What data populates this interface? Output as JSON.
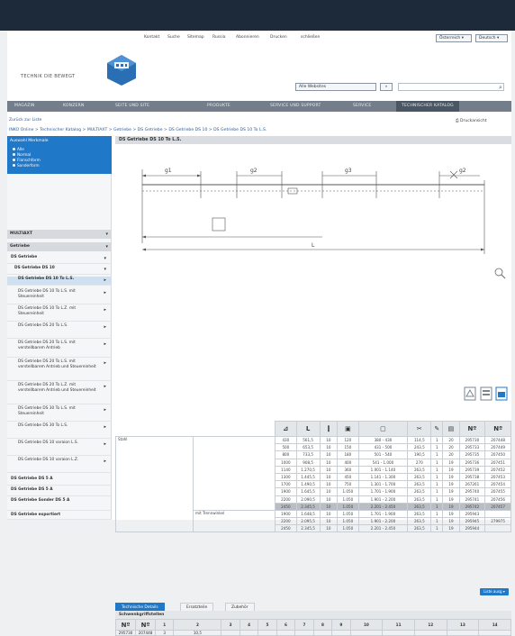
{
  "top_nav": {
    "links": [
      "Kontakt",
      "Suche",
      "Sitemap",
      "Russia",
      "Abonnieren",
      "Drucken",
      "schließen"
    ],
    "lang_selects": [
      "Österreich ▾",
      "Deutsch ▾"
    ]
  },
  "brand": {
    "tagline": "TECHNIK DIE BEWEGT"
  },
  "search": {
    "select_value": "Alle Websites",
    "go_label": "»",
    "placeholder": ""
  },
  "main_nav": [
    "MAGAZIN",
    "KONZERN",
    "SEITE UND SITE",
    "PRODUKTE",
    "SERVICE UND SUPPORT",
    "SERVICE",
    "TECHNISCHER KATALOG"
  ],
  "sub_bar": {
    "left_link": "Zurück zur Liste",
    "right_link": "Druckansicht"
  },
  "breadcrumb": "INKO Online > Technischer Katalog > MULTIAXT > Getriebe > DS Getriebe > DS Getriebe DS 10 > DS Getriebe DS 10 To L.S.",
  "sidebar": {
    "filter_title": "Auswahl Merkmale",
    "filter_options": [
      "Alle",
      "Normal",
      "Flanschform",
      "Sonderform"
    ],
    "sections": [
      {
        "label": "MULTIAXT",
        "arrow": "▾"
      },
      {
        "label": "Getriebe",
        "arrow": "▾"
      }
    ],
    "items": [
      {
        "label": "DS Getriebe",
        "arrow": "▾"
      },
      {
        "label": "DS Getriebe DS 10",
        "arrow": "▾"
      },
      {
        "label": "DS Getriebe DS 10 To L.S.",
        "arrow": "▸"
      },
      {
        "label": "DS Getriebe DS 10 To L.S. mit Steuereinheit",
        "arrow": "▸"
      },
      {
        "label": "DS Getriebe DS 10 To L.Z. mit Steuereinheit",
        "arrow": "▸"
      },
      {
        "label": "DS Getriebe DS 20 To L.S.",
        "arrow": "▸"
      },
      {
        "label": "DS Getriebe DS 20 To L.S. mit verstellbarem Antrieb",
        "arrow": "▸"
      },
      {
        "label": "DS Getriebe DS 20 To L.S. mit verstellbarem Antrieb und Steuereinheit",
        "arrow": "▸"
      },
      {
        "label": "DS Getriebe DS 20 To L.Z. mit verstellbarem Antrieb und Steuereinheit",
        "arrow": "▸"
      },
      {
        "label": "DS Getriebe DS 30 To L.S. mit Steuereinheit",
        "arrow": "▸"
      },
      {
        "label": "DS Getriebe DS 30 To L.S.",
        "arrow": "▸"
      },
      {
        "label": "DS Getriebe DS 10 varaion L.S.",
        "arrow": "▸"
      },
      {
        "label": "DS Getriebe DS 10 varaion L.Z.",
        "arrow": "▸"
      },
      {
        "label": "DS Getriebe DS 5 A",
        "arrow": ""
      },
      {
        "label": "DS Getriebe DS 5 A",
        "arrow": ""
      },
      {
        "label": "DS Getriebe Sonder DS 5 A",
        "arrow": ""
      },
      {
        "label": "DS Getriebe exportiert",
        "arrow": ""
      }
    ]
  },
  "product": {
    "title": "DS Getriebe DS 10 To L.S.",
    "drawing_labels": [
      "g1",
      "g2",
      "g3",
      "L",
      "g2"
    ]
  },
  "price_table": {
    "head_symbols": [
      "L",
      "",
      "",
      "",
      "",
      "",
      "",
      "Nº",
      "Nº"
    ],
    "group_labels": {
      "row0": "Stahl",
      "row12": "mit Trennwinkel"
    },
    "rows": [
      [
        "430",
        "561,5",
        "10",
        "120",
        "380 - 430",
        "114,5",
        "1",
        "20",
        "295730",
        "207448"
      ],
      [
        "500",
        "653,5",
        "10",
        "150",
        "431 - 500",
        "243,5",
        "1",
        "20",
        "295733",
        "207449"
      ],
      [
        "800",
        "733,5",
        "10",
        "180",
        "501 - 540",
        "190,5",
        "1",
        "20",
        "295735",
        "207450"
      ],
      [
        "1000",
        "908,5",
        "10",
        "400",
        "541 - 1.000",
        "270",
        "1",
        "19",
        "295736",
        "207451"
      ],
      [
        "1140",
        "1.270,5",
        "10",
        "360",
        "1.001 - 1.140",
        "263,5",
        "1",
        "19",
        "295739",
        "207452"
      ],
      [
        "1300",
        "1.445,5",
        "10",
        "450",
        "1.141 - 1.300",
        "263,5",
        "1",
        "19",
        "295738",
        "207453"
      ],
      [
        "1700",
        "1.490,5",
        "10",
        "750",
        "1.301 - 1.700",
        "263,5",
        "1",
        "19",
        "267261",
        "207454"
      ],
      [
        "1900",
        "1.645,5",
        "10",
        "1.050",
        "1.701 - 1.900",
        "263,5",
        "1",
        "19",
        "295740",
        "207455"
      ],
      [
        "2200",
        "2.090,5",
        "10",
        "1.050",
        "1.901 - 2.200",
        "263,5",
        "1",
        "19",
        "295741",
        "207456"
      ],
      [
        "2450",
        "2.345,5",
        "10",
        "1.050",
        "2.201 - 2.450",
        "263,5",
        "1",
        "19",
        "295742",
        "207457"
      ],
      [
        "1900",
        "1.648,5",
        "10",
        "1.050",
        "1.701 - 1.900",
        "263,5",
        "1",
        "19",
        "295943",
        ""
      ],
      [
        "2200",
        "2.095,5",
        "10",
        "1.050",
        "1.901 - 2.200",
        "263,5",
        "1",
        "19",
        "295945",
        "279975"
      ],
      [
        "2450",
        "2.345,5",
        "10",
        "1.050",
        "2.201 - 2.450",
        "263,5",
        "1",
        "19",
        "295944",
        ""
      ]
    ]
  },
  "load_more": "Liste ausg ▾",
  "tabs": [
    "Technische Details",
    "Ersatzteile",
    "Zubehör"
  ],
  "bottom_table": {
    "title": "Schwenkgriffstellen",
    "head": [
      "Nº",
      "Nº",
      "1",
      "2",
      "3",
      "4",
      "5",
      "6",
      "7",
      "8",
      "9",
      "10",
      "11",
      "12",
      "13",
      "14"
    ],
    "row": [
      "295730",
      "207448",
      "3",
      "10,5",
      "",
      "",
      "",
      "",
      "",
      "",
      "",
      "",
      "",
      "",
      "",
      ""
    ]
  }
}
